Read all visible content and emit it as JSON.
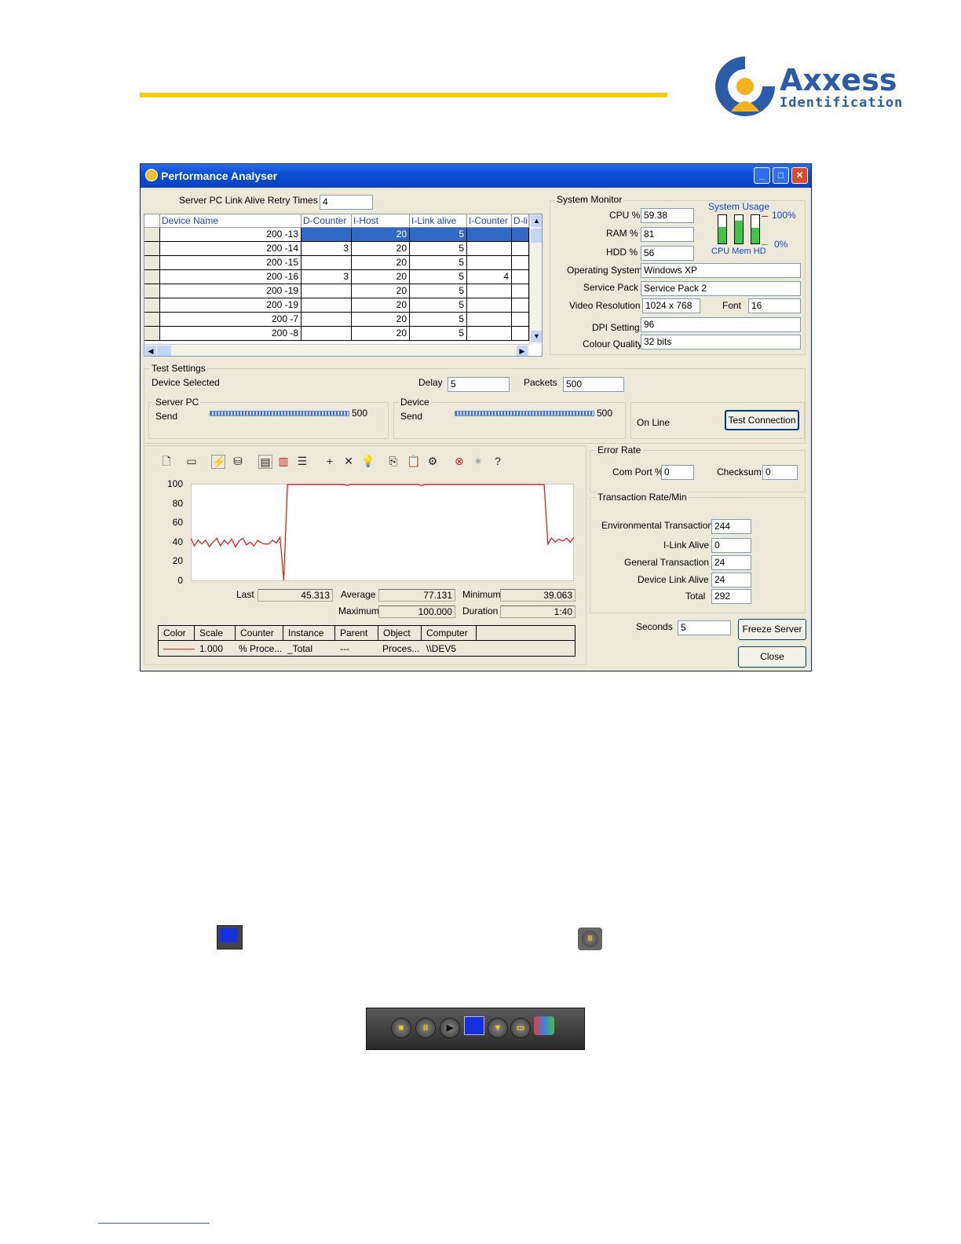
{
  "brand": {
    "name": "Axxess",
    "tagline": "Identification"
  },
  "window": {
    "title": "Performance Analyser",
    "minimize": "_",
    "maximize": "□",
    "close": "✕"
  },
  "server_pc": {
    "label": "Server PC  Link Alive Retry Times",
    "value": "4"
  },
  "grid": {
    "headers": [
      "Device Name",
      "D-Counter",
      "I-Host",
      "I-Link alive",
      "I-Counter",
      "D-li"
    ],
    "rows": [
      [
        "200 -13",
        "",
        "20",
        "5",
        "",
        ""
      ],
      [
        "200 -14",
        "3",
        "20",
        "5",
        "",
        ""
      ],
      [
        "200 -15",
        "",
        "20",
        "5",
        "",
        ""
      ],
      [
        "200 -16",
        "3",
        "20",
        "5",
        "4",
        ""
      ],
      [
        "200 -19",
        "",
        "20",
        "5",
        "",
        ""
      ],
      [
        "200 -19",
        "",
        "20",
        "5",
        "",
        ""
      ],
      [
        "200 -7",
        "",
        "20",
        "5",
        "",
        ""
      ],
      [
        "200 -8",
        "",
        "20",
        "5",
        "",
        ""
      ]
    ]
  },
  "system_monitor": {
    "title": "System Monitor",
    "cpu_label": "CPU %",
    "cpu": "59.38",
    "ram_label": "RAM %",
    "ram": "81",
    "hdd_label": "HDD %",
    "hdd": "56",
    "usage_title": "System Usage",
    "usage_max": "100%",
    "usage_min": "0%",
    "bar_labels": "CPU Mem HD",
    "os_label": "Operating System",
    "os": "Windows XP",
    "sp_label": "Service Pack",
    "sp": "Service Pack 2",
    "res_label": "Video Resolution",
    "res": "1024 x 768",
    "font_label": "Font",
    "font": "16",
    "dpi_label": "DPI Setting",
    "dpi": "96",
    "colour_label": "Colour Quality",
    "colour": "32 bits",
    "levels": {
      "cpu": 0.59,
      "mem": 0.81,
      "hd": 0.56
    }
  },
  "test_settings": {
    "title": "Test Settings",
    "device_selected": "Device Selected",
    "delay_label": "Delay",
    "delay": "5",
    "packets_label": "Packets",
    "packets": "500",
    "server_group": "Server PC",
    "server_send": "Send",
    "server_value": "500",
    "device_group": "Device",
    "device_send": "Send",
    "device_value": "500",
    "status": "On Line",
    "test_button": "Test Connection"
  },
  "chart": {
    "yticks": [
      "100",
      "80",
      "60",
      "40",
      "20",
      "0"
    ],
    "last_label": "Last",
    "last": "45.313",
    "avg_label": "Average",
    "avg": "77.131",
    "min_label": "Minimum",
    "min": "39.063",
    "max_label": "Maximum",
    "max": "100.000",
    "dur_label": "Duration",
    "dur": "1:40",
    "legend_headers": [
      "Color",
      "Scale",
      "Counter",
      "Instance",
      "Parent",
      "Object",
      "Computer"
    ],
    "legend_row": {
      "scale": "1.000",
      "counter": "% Proce...",
      "instance": "_Total",
      "parent": "---",
      "object": "Proces...",
      "computer": "\\\\DEV5"
    },
    "line_color": "#e02020"
  },
  "chart_data": {
    "type": "line",
    "ylim": [
      0,
      100
    ],
    "series": [
      {
        "values": [
          44,
          36,
          42,
          38,
          42,
          35,
          40,
          44,
          36,
          42,
          38,
          43,
          35,
          41,
          44,
          37,
          40,
          36,
          42,
          39,
          38,
          38,
          42,
          39,
          45,
          0,
          100,
          100,
          100,
          100,
          100,
          100,
          100,
          100,
          100,
          100,
          100,
          100,
          100,
          100,
          100,
          100,
          99,
          100,
          100,
          100,
          100,
          100,
          100,
          100,
          100,
          100,
          100,
          100,
          100,
          100,
          100,
          100,
          100,
          100,
          100,
          100,
          99,
          100,
          100,
          100,
          100,
          100,
          100,
          100,
          100,
          100,
          100,
          100,
          100,
          100,
          100,
          100,
          100,
          100,
          100,
          100,
          100,
          100,
          100,
          100,
          100,
          100,
          100,
          100,
          100,
          100,
          100,
          100,
          100,
          100,
          38,
          44,
          40,
          43,
          41,
          44,
          40,
          45
        ]
      }
    ]
  },
  "error_rate": {
    "title": "Error Rate",
    "com_label": "Com Port %",
    "com": "0",
    "checksum_label": "Checksum",
    "checksum": "0"
  },
  "transaction": {
    "title": "Transaction Rate/Min",
    "env_label": "Environmental Transaction",
    "env": "244",
    "ilink_label": "I-Link Alive",
    "ilink": "0",
    "general_label": "General Transaction",
    "general": "24",
    "devlink_label": "Device Link Alive",
    "devlink": "24",
    "total_label": "Total",
    "total": "292"
  },
  "seconds": {
    "label": "Seconds",
    "value": "5"
  },
  "buttons": {
    "freeze": "Freeze Server",
    "close": "Close"
  }
}
